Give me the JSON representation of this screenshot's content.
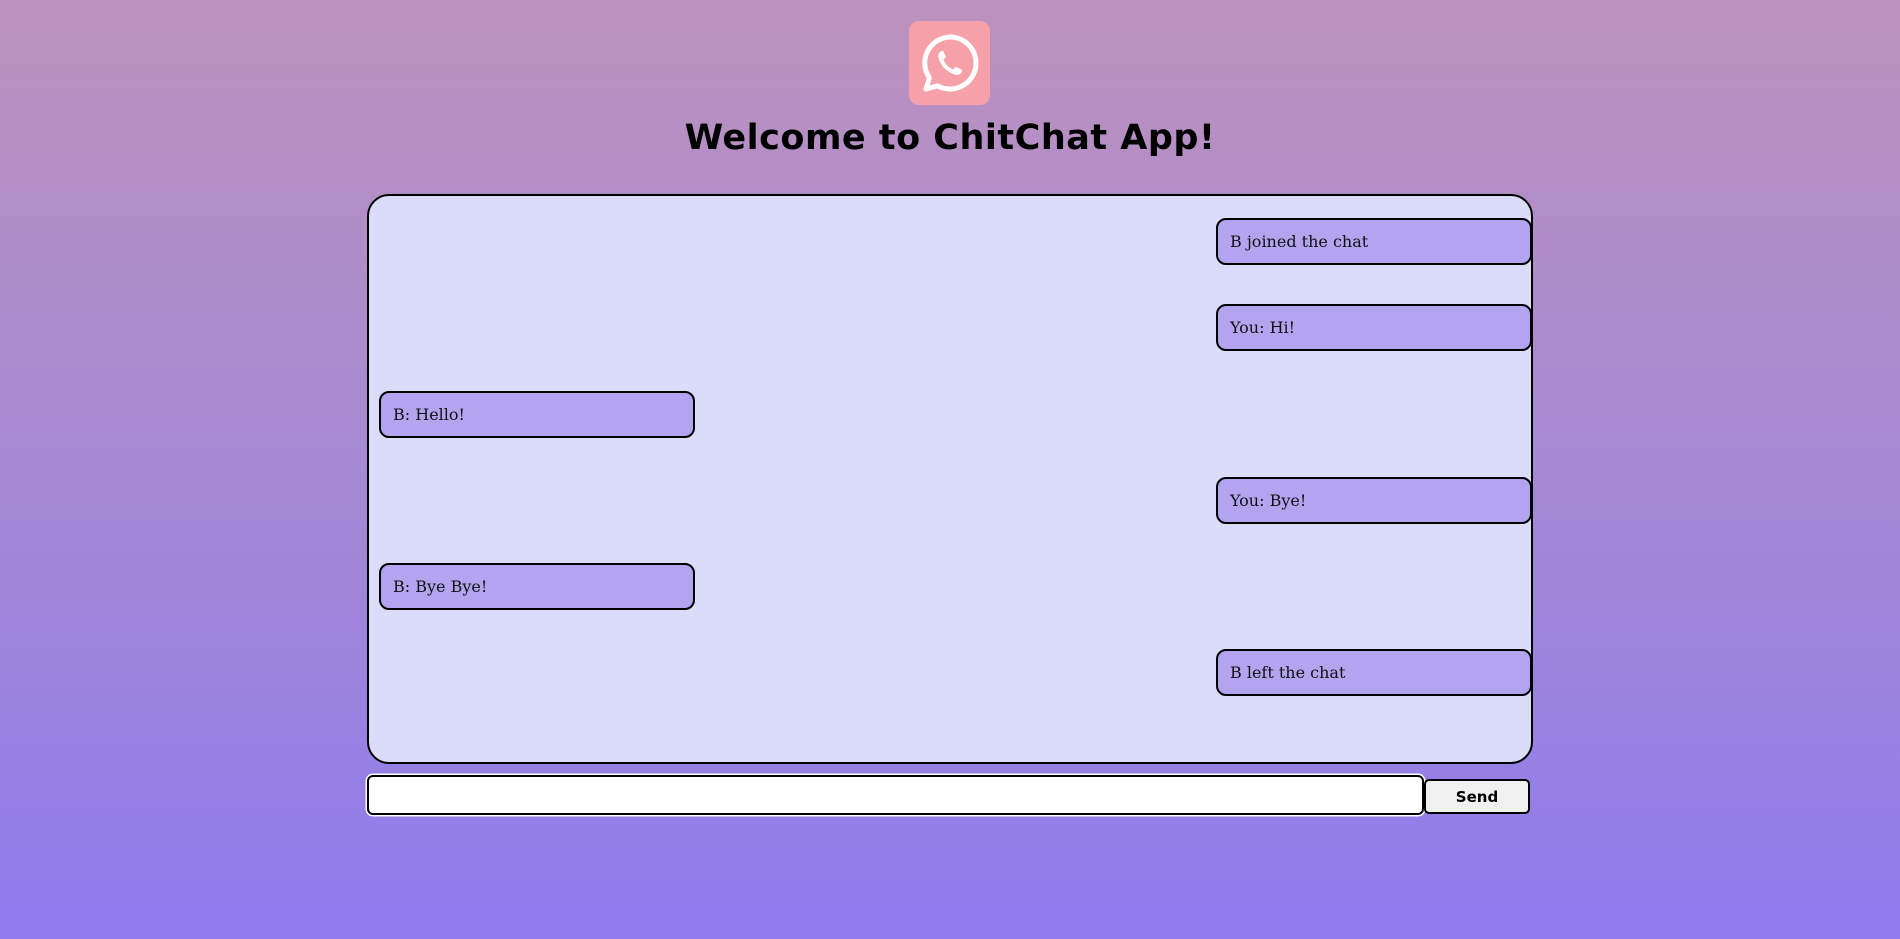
{
  "app": {
    "logo_icon": "whatsapp-chat-icon",
    "title": "Welcome to ChitChat App!"
  },
  "chat": {
    "messages": [
      {
        "side": "right",
        "text": "B joined the chat"
      },
      {
        "side": "right",
        "text": "You: Hi!"
      },
      {
        "side": "left",
        "text": "B: Hello!"
      },
      {
        "side": "right",
        "text": "You: Bye!"
      },
      {
        "side": "left",
        "text": "B: Bye Bye!"
      },
      {
        "side": "right",
        "text": "B left the chat"
      }
    ]
  },
  "composer": {
    "input_value": "",
    "placeholder": "",
    "send_label": "Send"
  },
  "colors": {
    "background_top": "#bc91bd",
    "background_bottom": "#8f7bee",
    "chat_background": "#dadcfa",
    "bubble": "#b3a4f0",
    "logo": "#f6a1a9"
  }
}
